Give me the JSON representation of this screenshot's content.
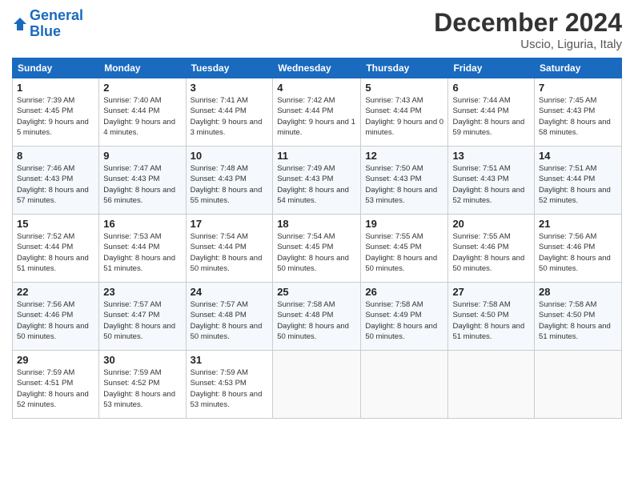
{
  "header": {
    "logo_line1": "General",
    "logo_line2": "Blue",
    "month": "December 2024",
    "location": "Uscio, Liguria, Italy"
  },
  "weekdays": [
    "Sunday",
    "Monday",
    "Tuesday",
    "Wednesday",
    "Thursday",
    "Friday",
    "Saturday"
  ],
  "weeks": [
    [
      {
        "day": "1",
        "sunrise": "7:39 AM",
        "sunset": "4:45 PM",
        "daylight": "9 hours and 5 minutes."
      },
      {
        "day": "2",
        "sunrise": "7:40 AM",
        "sunset": "4:44 PM",
        "daylight": "9 hours and 4 minutes."
      },
      {
        "day": "3",
        "sunrise": "7:41 AM",
        "sunset": "4:44 PM",
        "daylight": "9 hours and 3 minutes."
      },
      {
        "day": "4",
        "sunrise": "7:42 AM",
        "sunset": "4:44 PM",
        "daylight": "9 hours and 1 minute."
      },
      {
        "day": "5",
        "sunrise": "7:43 AM",
        "sunset": "4:44 PM",
        "daylight": "9 hours and 0 minutes."
      },
      {
        "day": "6",
        "sunrise": "7:44 AM",
        "sunset": "4:44 PM",
        "daylight": "8 hours and 59 minutes."
      },
      {
        "day": "7",
        "sunrise": "7:45 AM",
        "sunset": "4:43 PM",
        "daylight": "8 hours and 58 minutes."
      }
    ],
    [
      {
        "day": "8",
        "sunrise": "7:46 AM",
        "sunset": "4:43 PM",
        "daylight": "8 hours and 57 minutes."
      },
      {
        "day": "9",
        "sunrise": "7:47 AM",
        "sunset": "4:43 PM",
        "daylight": "8 hours and 56 minutes."
      },
      {
        "day": "10",
        "sunrise": "7:48 AM",
        "sunset": "4:43 PM",
        "daylight": "8 hours and 55 minutes."
      },
      {
        "day": "11",
        "sunrise": "7:49 AM",
        "sunset": "4:43 PM",
        "daylight": "8 hours and 54 minutes."
      },
      {
        "day": "12",
        "sunrise": "7:50 AM",
        "sunset": "4:43 PM",
        "daylight": "8 hours and 53 minutes."
      },
      {
        "day": "13",
        "sunrise": "7:51 AM",
        "sunset": "4:43 PM",
        "daylight": "8 hours and 52 minutes."
      },
      {
        "day": "14",
        "sunrise": "7:51 AM",
        "sunset": "4:44 PM",
        "daylight": "8 hours and 52 minutes."
      }
    ],
    [
      {
        "day": "15",
        "sunrise": "7:52 AM",
        "sunset": "4:44 PM",
        "daylight": "8 hours and 51 minutes."
      },
      {
        "day": "16",
        "sunrise": "7:53 AM",
        "sunset": "4:44 PM",
        "daylight": "8 hours and 51 minutes."
      },
      {
        "day": "17",
        "sunrise": "7:54 AM",
        "sunset": "4:44 PM",
        "daylight": "8 hours and 50 minutes."
      },
      {
        "day": "18",
        "sunrise": "7:54 AM",
        "sunset": "4:45 PM",
        "daylight": "8 hours and 50 minutes."
      },
      {
        "day": "19",
        "sunrise": "7:55 AM",
        "sunset": "4:45 PM",
        "daylight": "8 hours and 50 minutes."
      },
      {
        "day": "20",
        "sunrise": "7:55 AM",
        "sunset": "4:46 PM",
        "daylight": "8 hours and 50 minutes."
      },
      {
        "day": "21",
        "sunrise": "7:56 AM",
        "sunset": "4:46 PM",
        "daylight": "8 hours and 50 minutes."
      }
    ],
    [
      {
        "day": "22",
        "sunrise": "7:56 AM",
        "sunset": "4:46 PM",
        "daylight": "8 hours and 50 minutes."
      },
      {
        "day": "23",
        "sunrise": "7:57 AM",
        "sunset": "4:47 PM",
        "daylight": "8 hours and 50 minutes."
      },
      {
        "day": "24",
        "sunrise": "7:57 AM",
        "sunset": "4:48 PM",
        "daylight": "8 hours and 50 minutes."
      },
      {
        "day": "25",
        "sunrise": "7:58 AM",
        "sunset": "4:48 PM",
        "daylight": "8 hours and 50 minutes."
      },
      {
        "day": "26",
        "sunrise": "7:58 AM",
        "sunset": "4:49 PM",
        "daylight": "8 hours and 50 minutes."
      },
      {
        "day": "27",
        "sunrise": "7:58 AM",
        "sunset": "4:50 PM",
        "daylight": "8 hours and 51 minutes."
      },
      {
        "day": "28",
        "sunrise": "7:58 AM",
        "sunset": "4:50 PM",
        "daylight": "8 hours and 51 minutes."
      }
    ],
    [
      {
        "day": "29",
        "sunrise": "7:59 AM",
        "sunset": "4:51 PM",
        "daylight": "8 hours and 52 minutes."
      },
      {
        "day": "30",
        "sunrise": "7:59 AM",
        "sunset": "4:52 PM",
        "daylight": "8 hours and 53 minutes."
      },
      {
        "day": "31",
        "sunrise": "7:59 AM",
        "sunset": "4:53 PM",
        "daylight": "8 hours and 53 minutes."
      },
      null,
      null,
      null,
      null
    ]
  ]
}
